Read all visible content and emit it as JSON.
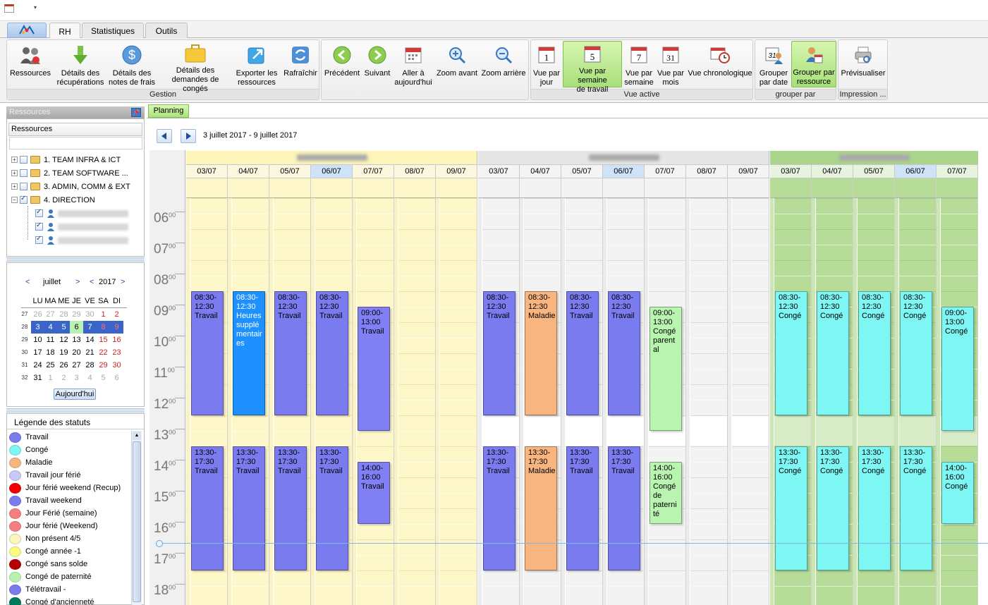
{
  "ribbon": {
    "tabs": [
      "RH",
      "Statistiques",
      "Outils"
    ],
    "active_tab": "RH",
    "groups": {
      "gestion": "Gestion",
      "vue_active": "Vue active",
      "grouper": "grouper par",
      "impression": "Impression ..."
    },
    "buttons": {
      "ressources": "Ressources",
      "details_recup_1": "Détails des",
      "details_recup_2": "récupérations",
      "details_frais_1": "Détails des",
      "details_frais_2": "notes de frais",
      "details_conges_1": "Détails des",
      "details_conges_2": "demandes de congés",
      "exporter_1": "Exporter les",
      "exporter_2": "ressources",
      "rafraichir": "Rafraîchir",
      "precedent": "Précédent",
      "suivant": "Suivant",
      "aller_1": "Aller à",
      "aller_2": "aujourd'hui",
      "zoom_avant": "Zoom avant",
      "zoom_arriere": "Zoom arrière",
      "vue_jour_1": "Vue par",
      "vue_jour_2": "jour",
      "vue_semaine_travail_1": "Vue par semaine",
      "vue_semaine_travail_2": "de travail",
      "vue_semaine_1": "Vue par",
      "vue_semaine_2": "semaine",
      "vue_mois_1": "Vue par",
      "vue_mois_2": "mois",
      "vue_chrono": "Vue chronologique",
      "grouper_date_1": "Grouper",
      "grouper_date_2": "par date",
      "grouper_ressource_1": "Grouper par",
      "grouper_ressource_2": "ressource",
      "previsualiser": "Prévisualiser"
    },
    "icon_numbers": {
      "jour": "1",
      "semaine_travail": "5",
      "semaine": "7",
      "mois": "31",
      "grouper_date": "31"
    }
  },
  "left": {
    "resources_header": "Ressources",
    "resources_column": "Ressources",
    "tree": [
      "1. TEAM INFRA & ICT",
      "2. TEAM SOFTWARE ...",
      "3. ADMIN, COMM & EXT",
      "4. DIRECTION"
    ],
    "calendar": {
      "month": "juillet",
      "year": "2017",
      "weekdays": [
        "LU",
        "MA",
        "ME",
        "JE",
        "VE",
        "SA",
        "DI"
      ],
      "weeks": [
        "27",
        "28",
        "29",
        "30",
        "31",
        "32"
      ],
      "rows": [
        [
          "26",
          "27",
          "28",
          "29",
          "30",
          "1",
          "2"
        ],
        [
          "3",
          "4",
          "5",
          "6",
          "7",
          "8",
          "9"
        ],
        [
          "10",
          "11",
          "12",
          "13",
          "14",
          "15",
          "16"
        ],
        [
          "17",
          "18",
          "19",
          "20",
          "21",
          "22",
          "23"
        ],
        [
          "24",
          "25",
          "26",
          "27",
          "28",
          "29",
          "30"
        ],
        [
          "31",
          "1",
          "2",
          "3",
          "4",
          "5",
          "6"
        ]
      ],
      "today_button": "Aujourd'hui"
    },
    "legend": {
      "title": "Légende des statuts",
      "items": [
        {
          "label": "Travail",
          "color": "#7b7bf0"
        },
        {
          "label": "Congé",
          "color": "#7ef7f4"
        },
        {
          "label": "Maladie",
          "color": "#f7b57f"
        },
        {
          "label": "Travail jour férié",
          "color": "#c9c9f7"
        },
        {
          "label": "Jour férié weekend (Recup)",
          "color": "#f40000"
        },
        {
          "label": "Travail weekend",
          "color": "#7b7bf0"
        },
        {
          "label": "Jour Férié (semaine)",
          "color": "#f57f7f"
        },
        {
          "label": "Jour férié (Weekend)",
          "color": "#f57f7f"
        },
        {
          "label": "Non présent 4/5",
          "color": "#fbf4bc"
        },
        {
          "label": "Congé année -1",
          "color": "#fbfb80"
        },
        {
          "label": "Congé sans solde",
          "color": "#b40000"
        },
        {
          "label": "Congé de paternité",
          "color": "#b9f2b0"
        },
        {
          "label": "Télétravail -",
          "color": "#7b7bf0"
        },
        {
          "label": "Congé d'ancienneté",
          "color": "#007a5c"
        }
      ]
    }
  },
  "main": {
    "planning_tab": "Planning",
    "range": "3 juillet 2017 - 9 juillet 2017",
    "hours": [
      "06",
      "07",
      "08",
      "09",
      "10",
      "11",
      "12",
      "13",
      "14",
      "15",
      "16",
      "17",
      "18"
    ],
    "groups": [
      {
        "days": [
          "03/07",
          "04/07",
          "05/07",
          "06/07",
          "07/07",
          "08/07",
          "09/07"
        ]
      },
      {
        "days": [
          "03/07",
          "04/07",
          "05/07",
          "06/07",
          "07/07",
          "08/07",
          "09/07"
        ]
      },
      {
        "days": [
          "03/07",
          "04/07",
          "05/07",
          "06/07",
          "07/07"
        ]
      }
    ],
    "appointments": [
      {
        "g": 0,
        "d": 0,
        "s": 8.5,
        "e": 12.5,
        "lines": [
          "08:30-",
          "12:30",
          "Travail"
        ],
        "color": "#7b7bf0",
        "text": "#000"
      },
      {
        "g": 0,
        "d": 1,
        "s": 8.5,
        "e": 12.5,
        "lines": [
          "08:30-",
          "12:30",
          "Heures",
          "supplé",
          "mentair",
          "es"
        ],
        "color": "#1e90ff",
        "text": "#fff"
      },
      {
        "g": 0,
        "d": 2,
        "s": 8.5,
        "e": 12.5,
        "lines": [
          "08:30-",
          "12:30",
          "Travail"
        ],
        "color": "#7b7bf0",
        "text": "#000"
      },
      {
        "g": 0,
        "d": 3,
        "s": 8.5,
        "e": 12.5,
        "lines": [
          "08:30-",
          "12:30",
          "Travail"
        ],
        "color": "#7b7bf0",
        "text": "#000"
      },
      {
        "g": 0,
        "d": 4,
        "s": 9,
        "e": 13,
        "lines": [
          "09:00-",
          "13:00",
          "Travail"
        ],
        "color": "#8080f4",
        "text": "#000"
      },
      {
        "g": 0,
        "d": 0,
        "s": 13.5,
        "e": 17.5,
        "lines": [
          "13:30-",
          "17:30",
          "Travail"
        ],
        "color": "#7b7bf0",
        "text": "#000"
      },
      {
        "g": 0,
        "d": 1,
        "s": 13.5,
        "e": 17.5,
        "lines": [
          "13:30-",
          "17:30",
          "Travail"
        ],
        "color": "#7b7bf0",
        "text": "#000"
      },
      {
        "g": 0,
        "d": 2,
        "s": 13.5,
        "e": 17.5,
        "lines": [
          "13:30-",
          "17:30",
          "Travail"
        ],
        "color": "#7b7bf0",
        "text": "#000"
      },
      {
        "g": 0,
        "d": 3,
        "s": 13.5,
        "e": 17.5,
        "lines": [
          "13:30-",
          "17:30",
          "Travail"
        ],
        "color": "#7b7bf0",
        "text": "#000"
      },
      {
        "g": 0,
        "d": 4,
        "s": 14,
        "e": 16,
        "lines": [
          "14:00-",
          "16:00",
          "Travail"
        ],
        "color": "#8080f4",
        "text": "#000"
      },
      {
        "g": 1,
        "d": 0,
        "s": 8.5,
        "e": 12.5,
        "lines": [
          "08:30-",
          "12:30",
          "Travail"
        ],
        "color": "#7b7bf0",
        "text": "#000"
      },
      {
        "g": 1,
        "d": 1,
        "s": 8.5,
        "e": 12.5,
        "lines": [
          "08:30-",
          "12:30",
          "Maladie"
        ],
        "color": "#f9b57f",
        "text": "#000"
      },
      {
        "g": 1,
        "d": 2,
        "s": 8.5,
        "e": 12.5,
        "lines": [
          "08:30-",
          "12:30",
          "Travail"
        ],
        "color": "#7b7bf0",
        "text": "#000"
      },
      {
        "g": 1,
        "d": 3,
        "s": 8.5,
        "e": 12.5,
        "lines": [
          "08:30-",
          "12:30",
          "Travail"
        ],
        "color": "#7b7bf0",
        "text": "#000"
      },
      {
        "g": 1,
        "d": 4,
        "s": 9,
        "e": 13,
        "lines": [
          "09:00-",
          "13:00",
          "Congé",
          "parent",
          "al"
        ],
        "color": "#b9f4b0",
        "text": "#000"
      },
      {
        "g": 1,
        "d": 0,
        "s": 13.5,
        "e": 17.5,
        "lines": [
          "13:30-",
          "17:30",
          "Travail"
        ],
        "color": "#7b7bf0",
        "text": "#000"
      },
      {
        "g": 1,
        "d": 1,
        "s": 13.5,
        "e": 17.5,
        "lines": [
          "13:30-",
          "17:30",
          "Maladie"
        ],
        "color": "#f9b57f",
        "text": "#000"
      },
      {
        "g": 1,
        "d": 2,
        "s": 13.5,
        "e": 17.5,
        "lines": [
          "13:30-",
          "17:30",
          "Travail"
        ],
        "color": "#7b7bf0",
        "text": "#000"
      },
      {
        "g": 1,
        "d": 3,
        "s": 13.5,
        "e": 17.5,
        "lines": [
          "13:30-",
          "17:30",
          "Travail"
        ],
        "color": "#7b7bf0",
        "text": "#000"
      },
      {
        "g": 1,
        "d": 4,
        "s": 14,
        "e": 16,
        "lines": [
          "14:00-",
          "16:00",
          "Congé",
          "de",
          "paterni",
          "té"
        ],
        "color": "#b9f4b0",
        "text": "#000"
      },
      {
        "g": 2,
        "d": 0,
        "s": 8.5,
        "e": 12.5,
        "lines": [
          "08:30-",
          "12:30",
          "Congé"
        ],
        "color": "#7ef7f4",
        "text": "#000"
      },
      {
        "g": 2,
        "d": 1,
        "s": 8.5,
        "e": 12.5,
        "lines": [
          "08:30-",
          "12:30",
          "Congé"
        ],
        "color": "#7ef7f4",
        "text": "#000"
      },
      {
        "g": 2,
        "d": 2,
        "s": 8.5,
        "e": 12.5,
        "lines": [
          "08:30-",
          "12:30",
          "Congé"
        ],
        "color": "#7ef7f4",
        "text": "#000"
      },
      {
        "g": 2,
        "d": 3,
        "s": 8.5,
        "e": 12.5,
        "lines": [
          "08:30-",
          "12:30",
          "Congé"
        ],
        "color": "#7ef7f4",
        "text": "#000"
      },
      {
        "g": 2,
        "d": 4,
        "s": 9,
        "e": 13,
        "lines": [
          "09:00-",
          "13:00",
          "Congé"
        ],
        "color": "#7ef7f4",
        "text": "#000"
      },
      {
        "g": 2,
        "d": 0,
        "s": 13.5,
        "e": 17.5,
        "lines": [
          "13:30-",
          "17:30",
          "Congé"
        ],
        "color": "#7ef7f4",
        "text": "#000"
      },
      {
        "g": 2,
        "d": 1,
        "s": 13.5,
        "e": 17.5,
        "lines": [
          "13:30-",
          "17:30",
          "Congé"
        ],
        "color": "#7ef7f4",
        "text": "#000"
      },
      {
        "g": 2,
        "d": 2,
        "s": 13.5,
        "e": 17.5,
        "lines": [
          "13:30-",
          "17:30",
          "Congé"
        ],
        "color": "#7ef7f4",
        "text": "#000"
      },
      {
        "g": 2,
        "d": 3,
        "s": 13.5,
        "e": 17.5,
        "lines": [
          "13:30-",
          "17:30",
          "Congé"
        ],
        "color": "#7ef7f4",
        "text": "#000"
      },
      {
        "g": 2,
        "d": 4,
        "s": 14,
        "e": 16,
        "lines": [
          "14:00-",
          "16:00",
          "Congé"
        ],
        "color": "#7ef7f4",
        "text": "#000"
      }
    ]
  }
}
